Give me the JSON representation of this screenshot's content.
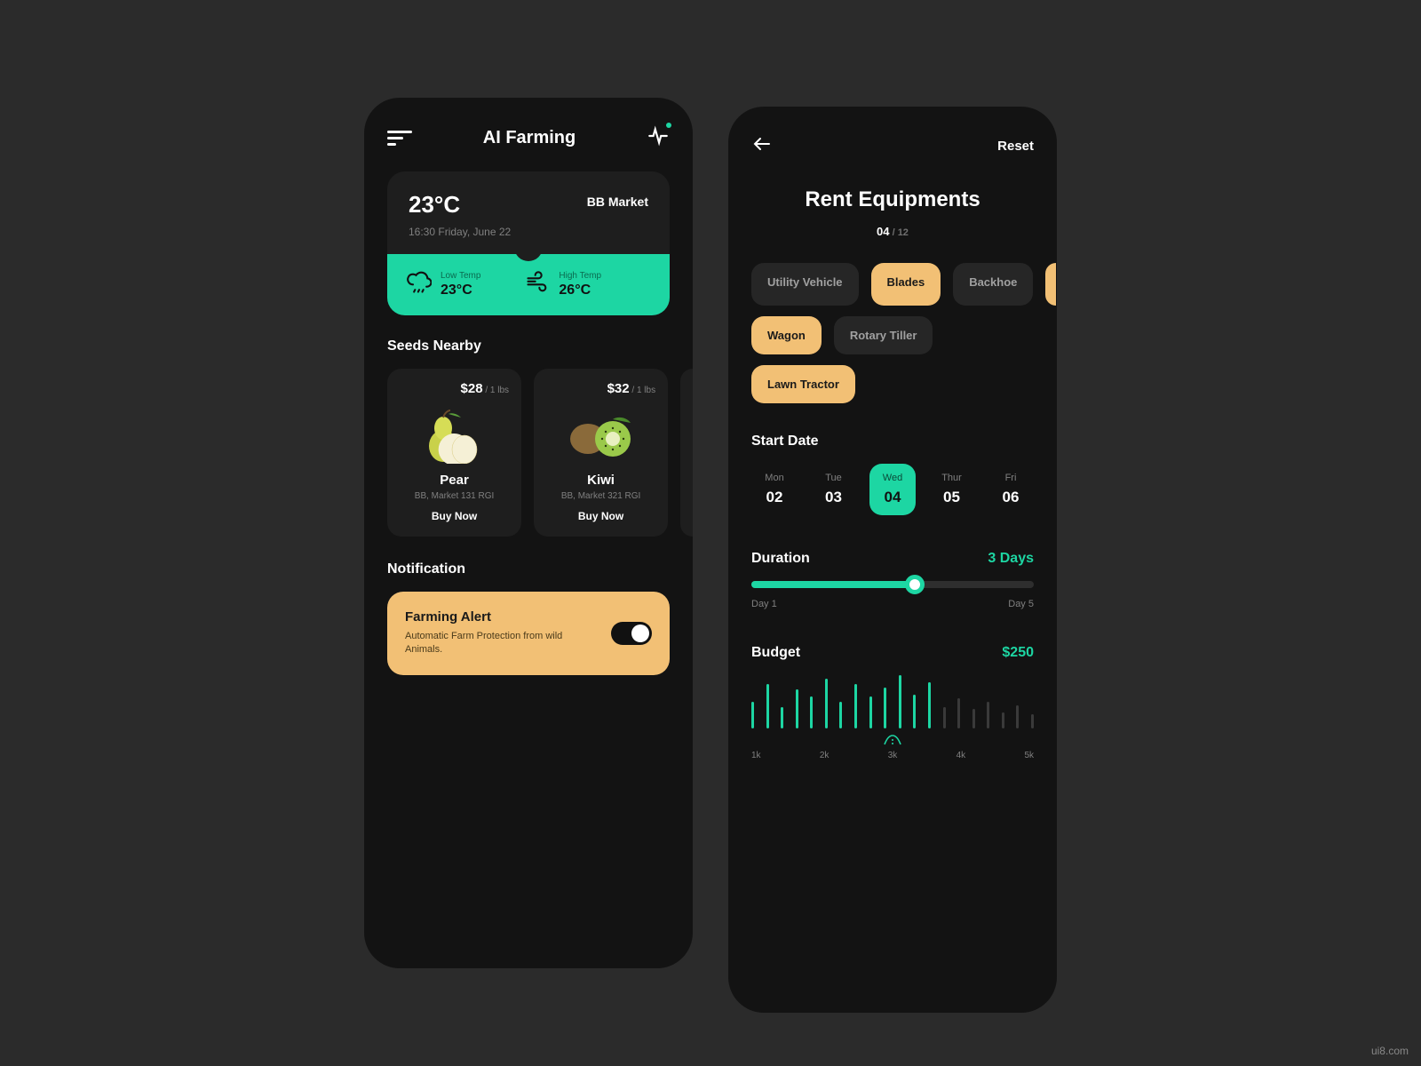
{
  "left": {
    "title": "AI Farming",
    "weather": {
      "temp": "23°C",
      "market": "BB Market",
      "datetime": "16:30 Friday, June 22",
      "low_label": "Low Temp",
      "low_val": "23°C",
      "high_label": "High Temp",
      "high_val": "26°C"
    },
    "seeds_heading": "Seeds Nearby",
    "seeds": [
      {
        "price": "$28",
        "unit": " / 1 lbs",
        "name": "Pear",
        "loc": "BB, Market 131 RGI",
        "cta": "Buy Now"
      },
      {
        "price": "$32",
        "unit": " / 1 lbs",
        "name": "Kiwi",
        "loc": "BB, Market 321 RGI",
        "cta": "Buy Now"
      }
    ],
    "notif_heading": "Notification",
    "notif": {
      "title": "Farming Alert",
      "desc": "Automatic Farm Protection from wild Animals."
    }
  },
  "right": {
    "reset": "Reset",
    "title": "Rent Equipments",
    "count_cur": "04",
    "count_sep": " / ",
    "count_tot": "12",
    "chips": [
      {
        "label": "Utility Vehicle",
        "active": false
      },
      {
        "label": "Blades",
        "active": true
      },
      {
        "label": "Backhoe",
        "active": false
      },
      {
        "label": "Wagon",
        "active": true
      },
      {
        "label": "Rotary Tiller",
        "active": false
      },
      {
        "label": "Lawn Tractor",
        "active": true
      }
    ],
    "start_heading": "Start Date",
    "dates": [
      {
        "day": "Mon",
        "num": "02",
        "active": false
      },
      {
        "day": "Tue",
        "num": "03",
        "active": false
      },
      {
        "day": "Wed",
        "num": "04",
        "active": true
      },
      {
        "day": "Thur",
        "num": "05",
        "active": false
      },
      {
        "day": "Fri",
        "num": "06",
        "active": false
      }
    ],
    "duration_heading": "Duration",
    "duration_value": "3 Days",
    "duration_min": "Day 1",
    "duration_max": "Day 5",
    "budget_heading": "Budget",
    "budget_value": "$250",
    "budget_ticks": [
      "1k",
      "2k",
      "3k",
      "4k",
      "5k"
    ],
    "budget_bars": [
      30,
      50,
      24,
      44,
      36,
      56,
      30,
      50,
      36,
      46,
      60,
      38,
      52,
      24,
      34,
      22,
      30,
      18,
      26,
      16
    ]
  },
  "watermark": "ui8.com"
}
